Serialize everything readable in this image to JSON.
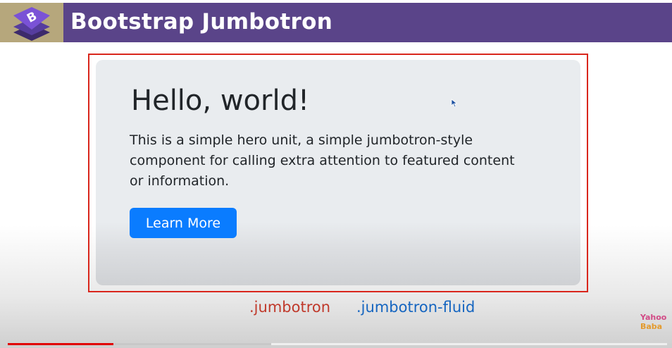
{
  "header": {
    "title": "Bootstrap Jumbotron",
    "logo_icon": "bootstrap-logo",
    "bg_color": "#5a4489"
  },
  "jumbotron": {
    "title": "Hello, world!",
    "lead": "This is a simple hero unit, a simple jumbotron-style component for calling extra attention to featured content or information.",
    "button_label": "Learn More",
    "button_color": "#0a7cff",
    "bg_color": "#e9ecef",
    "frame_color": "#d9261c"
  },
  "classes": [
    {
      "name": ".jumbotron",
      "color": "#c0392b"
    },
    {
      "name": ".jumbotron-fluid",
      "color": "#1565c0"
    }
  ],
  "watermark": {
    "line1": "Yahoo",
    "line2": "Baba"
  },
  "video_progress": {
    "played_fraction": 0.16,
    "buffered_fraction": 0.4
  }
}
